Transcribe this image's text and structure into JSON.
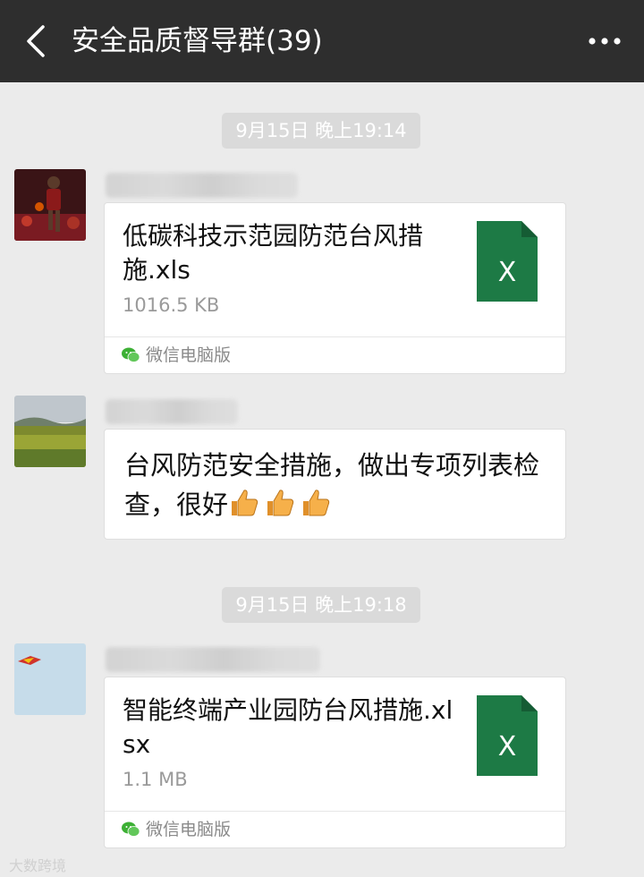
{
  "header": {
    "title": "安全品质督导群(39)",
    "back_icon": "chevron-left-icon",
    "more_icon": "more-dots-icon"
  },
  "messages": [
    {
      "type": "timestamp",
      "text": "9月15日 晚上19:14"
    },
    {
      "type": "file",
      "file_name": "低碳科技示范园防范台风措施.xls",
      "file_size": "1016.5 KB",
      "file_icon": "excel-file-icon",
      "file_icon_letter": "X",
      "footer": "微信电脑版"
    },
    {
      "type": "text",
      "text": "台风防范安全措施，做出专项列表检查，很好",
      "emoji": "thumbs-up-icon",
      "emoji_count": 3
    },
    {
      "type": "timestamp",
      "text": "9月15日 晚上19:18"
    },
    {
      "type": "file",
      "file_name": "智能终端产业园防台风措施.xlsx",
      "file_size": "1.1 MB",
      "file_icon": "excel-file-icon",
      "file_icon_letter": "X",
      "footer": "微信电脑版"
    }
  ],
  "watermark": "大数跨境",
  "colors": {
    "header_bg": "#2e2e2e",
    "chat_bg": "#ebebeb",
    "excel_green": "#1d7a45",
    "wechat_green": "#3cb034"
  }
}
